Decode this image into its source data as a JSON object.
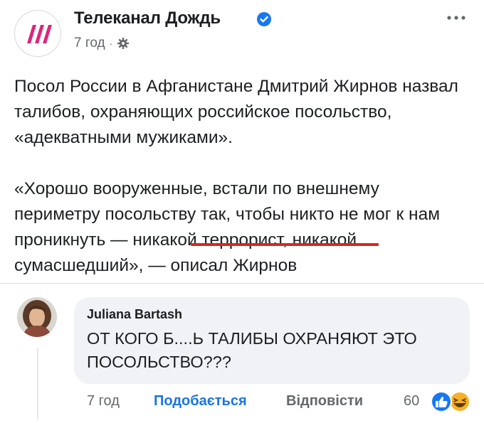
{
  "post": {
    "page_name": "Телеканал Дождь",
    "time": "7 год",
    "separator": "·",
    "paragraphs": [
      "Посол России в Афганистане Дмитрий Жирнов назвал талибов, охраняющих российское посольство, «адекватными мужиками».",
      "«Хорошо вооруженные, встали по внешнему периметру посольству так, чтобы никто не мог к нам проникнуть — никакой террорист, никакой сумасшедший», — описал Жирнов"
    ],
    "icons": {
      "avatar": "tv-rain-logo",
      "verified": "verified-badge-icon",
      "privacy": "gear-icon",
      "more": "more-horizontal-icon"
    },
    "colors": {
      "brand": "#e0247a",
      "verified": "#1877f2",
      "underline": "#d8261c"
    }
  },
  "comment": {
    "author": "Juliana Bartash",
    "text": "ОТ КОГО Б....Ь ТАЛИБЫ ОХРАНЯЮТ ЭТО ПОСОЛЬСТВО???",
    "actions": {
      "time": "7 год",
      "like": "Подобається",
      "reply": "Відповісти"
    },
    "reactions": {
      "count": "60",
      "types": [
        "like",
        "haha"
      ]
    },
    "colors": {
      "like_text": "#1b74e4",
      "bubble": "#f0f2f5"
    }
  }
}
